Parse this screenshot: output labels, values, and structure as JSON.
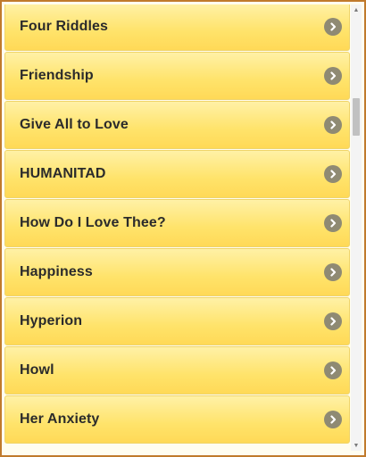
{
  "list": {
    "items": [
      {
        "label": "Four Riddles",
        "icon": "chevron-right-circle-icon"
      },
      {
        "label": "Friendship",
        "icon": "chevron-right-circle-icon"
      },
      {
        "label": "Give All to Love",
        "icon": "chevron-right-circle-icon"
      },
      {
        "label": "HUMANITAD",
        "icon": "chevron-right-circle-icon"
      },
      {
        "label": "How Do I Love Thee?",
        "icon": "chevron-right-circle-icon"
      },
      {
        "label": "Happiness",
        "icon": "chevron-right-circle-icon"
      },
      {
        "label": "Hyperion",
        "icon": "chevron-right-circle-icon"
      },
      {
        "label": "Howl",
        "icon": "chevron-right-circle-icon"
      },
      {
        "label": "Her Anxiety",
        "icon": "chevron-right-circle-icon"
      }
    ]
  },
  "scrollbar": {
    "up_icon": "scroll-up-arrow-icon",
    "down_icon": "scroll-down-arrow-icon"
  },
  "colors": {
    "frame_border": "#c07a2c",
    "item_gradient_top": "#fff1a6",
    "item_gradient_bottom": "#ffd957",
    "chevron_bg": "#8f8a73"
  }
}
